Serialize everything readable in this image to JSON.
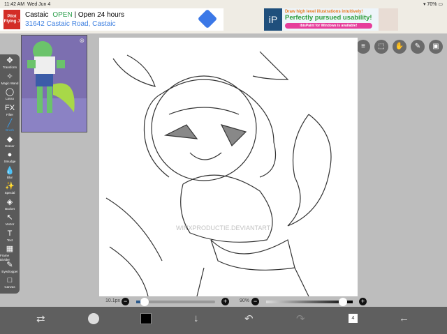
{
  "status": {
    "time": "11:42 AM",
    "date": "Wed Jun 4",
    "battery": "70%"
  },
  "ad_left": {
    "brand": "Pilot Flying J",
    "name": "Castaic",
    "open": "OPEN",
    "hours": "Open 24 hours",
    "address": "31642 Castaic Road, Castaic"
  },
  "ad_right": {
    "line1": "Draw high level illustrations intuitively!",
    "line2": "Perfectly pursued usability!",
    "line3": "ibisPaint for Windows is available!"
  },
  "tools": [
    {
      "icon": "✥",
      "label": "Transform"
    },
    {
      "icon": "✧",
      "label": "Magic Wand"
    },
    {
      "icon": "◯",
      "label": "Lasso"
    },
    {
      "icon": "FX",
      "label": "Filter"
    },
    {
      "icon": "╱",
      "label": "Brush"
    },
    {
      "icon": "◆",
      "label": "Eraser"
    },
    {
      "icon": "●",
      "label": "Smudge"
    },
    {
      "icon": "💧",
      "label": "Blur"
    },
    {
      "icon": "✨",
      "label": "Special"
    },
    {
      "icon": "◈",
      "label": "Bucket"
    },
    {
      "icon": "↖",
      "label": "Vector"
    },
    {
      "icon": "T",
      "label": "Text"
    },
    {
      "icon": "▦",
      "label": "Frame Divider"
    },
    {
      "icon": "✎",
      "label": "Eyedropper"
    },
    {
      "icon": "□",
      "label": "Canvas"
    }
  ],
  "active_tool": "Brush",
  "brush": {
    "size_label": "10.1px",
    "size_fraction": 0.1,
    "opacity_label": "90%",
    "opacity_fraction": 0.9
  },
  "watermark": "WINXPRODUCTIE.DEVIANTART",
  "layers_count": "4",
  "colors": {
    "primary_color": "#000000",
    "accent": "#3aa0f0"
  }
}
